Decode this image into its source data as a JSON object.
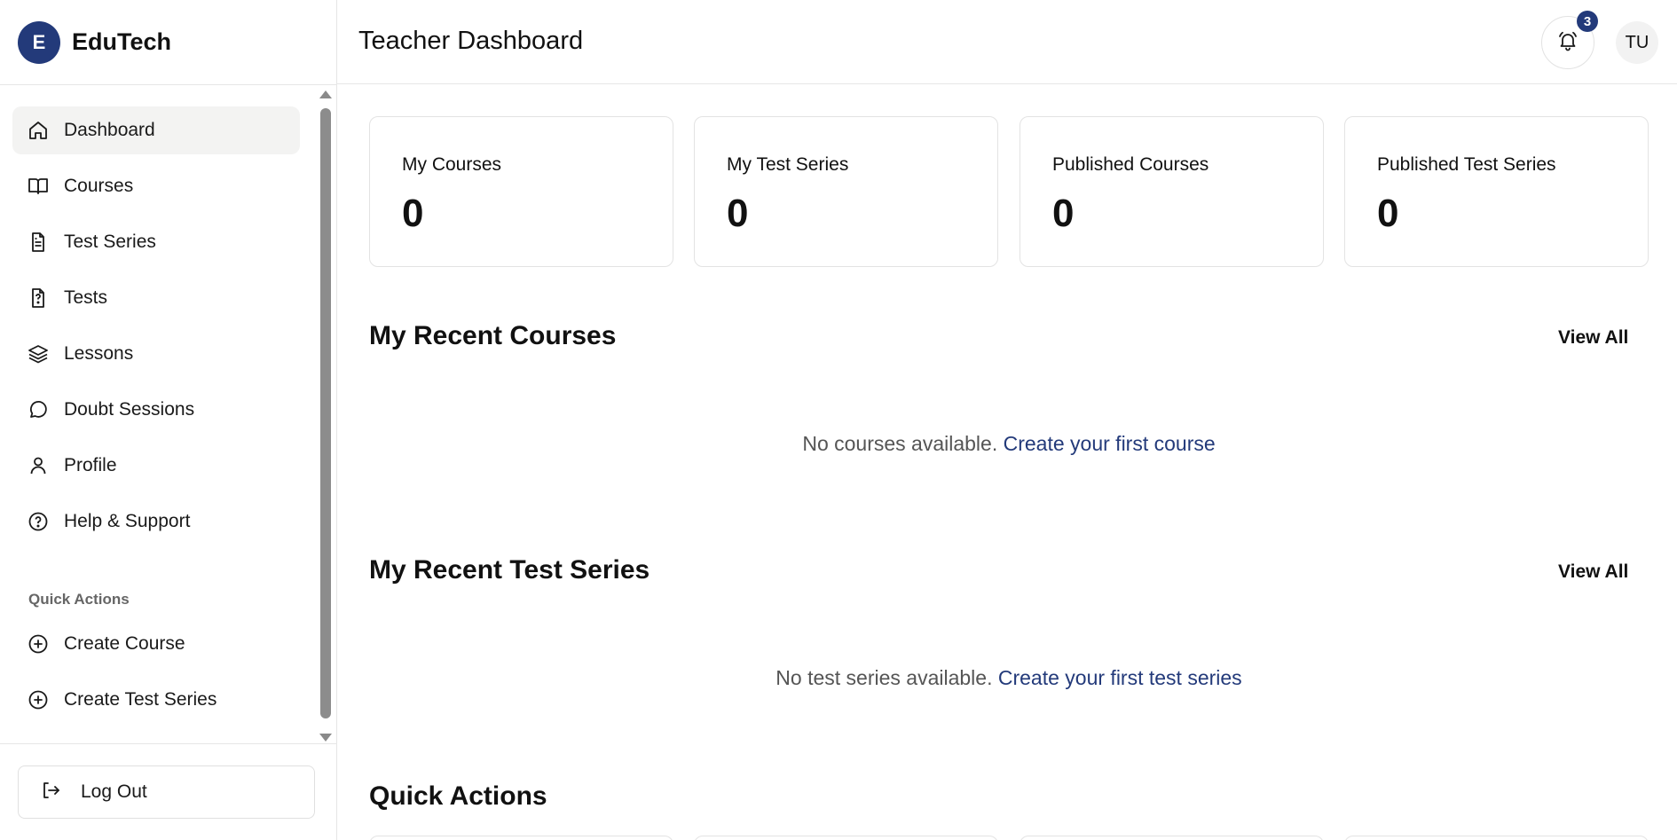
{
  "brand": {
    "logo_letter": "E",
    "name": "EduTech",
    "color": "#233a7a"
  },
  "sidebar": {
    "items": [
      {
        "label": "Dashboard",
        "icon": "home-icon",
        "active": true
      },
      {
        "label": "Courses",
        "icon": "book-icon"
      },
      {
        "label": "Test Series",
        "icon": "document-icon"
      },
      {
        "label": "Tests",
        "icon": "question-file-icon"
      },
      {
        "label": "Lessons",
        "icon": "layers-icon"
      },
      {
        "label": "Doubt Sessions",
        "icon": "chat-bubble-icon"
      },
      {
        "label": "Profile",
        "icon": "user-icon"
      },
      {
        "label": "Help & Support",
        "icon": "help-circle-icon"
      }
    ],
    "quick_actions_title": "Quick Actions",
    "quick_actions": [
      {
        "label": "Create Course",
        "icon": "plus-circle-icon"
      },
      {
        "label": "Create Test Series",
        "icon": "plus-circle-icon"
      }
    ],
    "logout_label": "Log Out"
  },
  "header": {
    "title": "Teacher Dashboard",
    "notification_count": "3",
    "avatar_initials": "TU"
  },
  "stats": [
    {
      "label": "My Courses",
      "value": "0"
    },
    {
      "label": "My Test Series",
      "value": "0"
    },
    {
      "label": "Published Courses",
      "value": "0"
    },
    {
      "label": "Published Test Series",
      "value": "0"
    }
  ],
  "recent_courses": {
    "title": "My Recent Courses",
    "view_all": "View All",
    "empty_text": "No courses available.",
    "empty_link": "Create your first course"
  },
  "recent_test_series": {
    "title": "My Recent Test Series",
    "view_all": "View All",
    "empty_text": "No test series available.",
    "empty_link": "Create your first test series"
  },
  "quick_actions_section": {
    "title": "Quick Actions"
  }
}
